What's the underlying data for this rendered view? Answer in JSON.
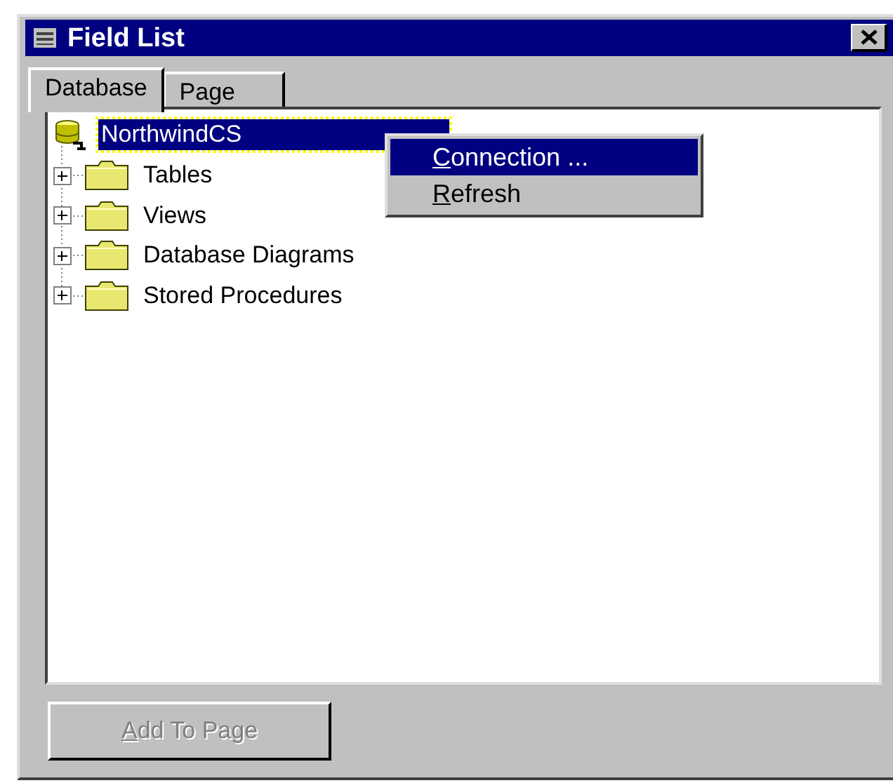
{
  "window": {
    "title": "Field List"
  },
  "tabs": [
    {
      "label": "Database",
      "selected": true
    },
    {
      "label": "Page",
      "selected": false
    }
  ],
  "tree": {
    "root": {
      "label": "NorthwindCS",
      "selected": true
    },
    "children": [
      {
        "label": "Tables",
        "expanded": false
      },
      {
        "label": "Views",
        "expanded": false
      },
      {
        "label": "Database Diagrams",
        "expanded": false
      },
      {
        "label": "Stored Procedures",
        "expanded": false
      }
    ]
  },
  "context_menu": {
    "items": [
      {
        "label": "Connection ...",
        "selected": true
      },
      {
        "label": "Refresh",
        "selected": false
      }
    ]
  },
  "buttons": [
    {
      "label": "Add To Page",
      "disabled": true
    }
  ]
}
